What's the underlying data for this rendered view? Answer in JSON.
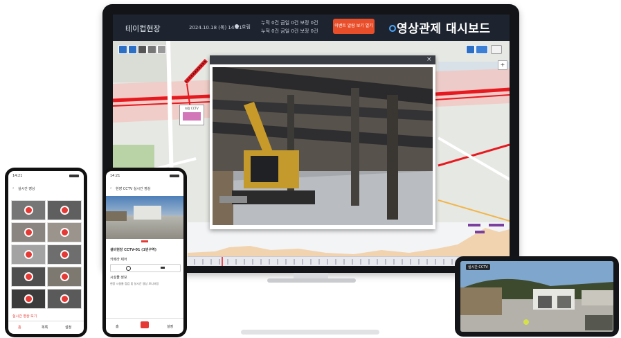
{
  "dashboard": {
    "brand": "테이컵현장",
    "header_date": "2024.10.18 (목) 14:21",
    "weather_label": "흐림",
    "stats_line1": "누적 0건  금일 0건  보정 0건",
    "stats_line2": "누적 0건  금일 0건  보정 0건",
    "alarm_button": "이벤트 알람 보기 열기",
    "title": "영상관제 대시보드",
    "map_popup_label": "현장 CCTV",
    "zoom_plus": "+",
    "zoom_minus": "−",
    "colors": {
      "header_bg": "#1d2430",
      "alarm": "#e94e2a",
      "route": "#e8181f",
      "accent": "#2d6fc4"
    }
  },
  "video_popup": {
    "close": "×",
    "subject": "excavator-under-steel-struts"
  },
  "phone_left": {
    "time": "14:21",
    "title": "실시간 영상",
    "thumbnails": 10,
    "footer_label": "실시간 영상 보기",
    "nav": [
      "홈",
      "목록",
      "설정"
    ]
  },
  "phone_mid": {
    "time": "14:21",
    "title": "현장 CCTV 실시간 영상",
    "camera_name": "설비현장 CCTV-01 (1번구역)",
    "control_label": "카메라 제어",
    "info_title": "시설물 정보",
    "info_text": "현장 시설물 점검 및 실시간 영상 모니터링",
    "nav": [
      "홈",
      "CCTV",
      "설정"
    ]
  },
  "tablet": {
    "badge": "실시간 CCTV"
  },
  "icons": [
    "layers-icon",
    "search-icon",
    "record-icon",
    "close-icon",
    "zoom-in-icon",
    "zoom-out-icon",
    "back-arrow-icon"
  ]
}
